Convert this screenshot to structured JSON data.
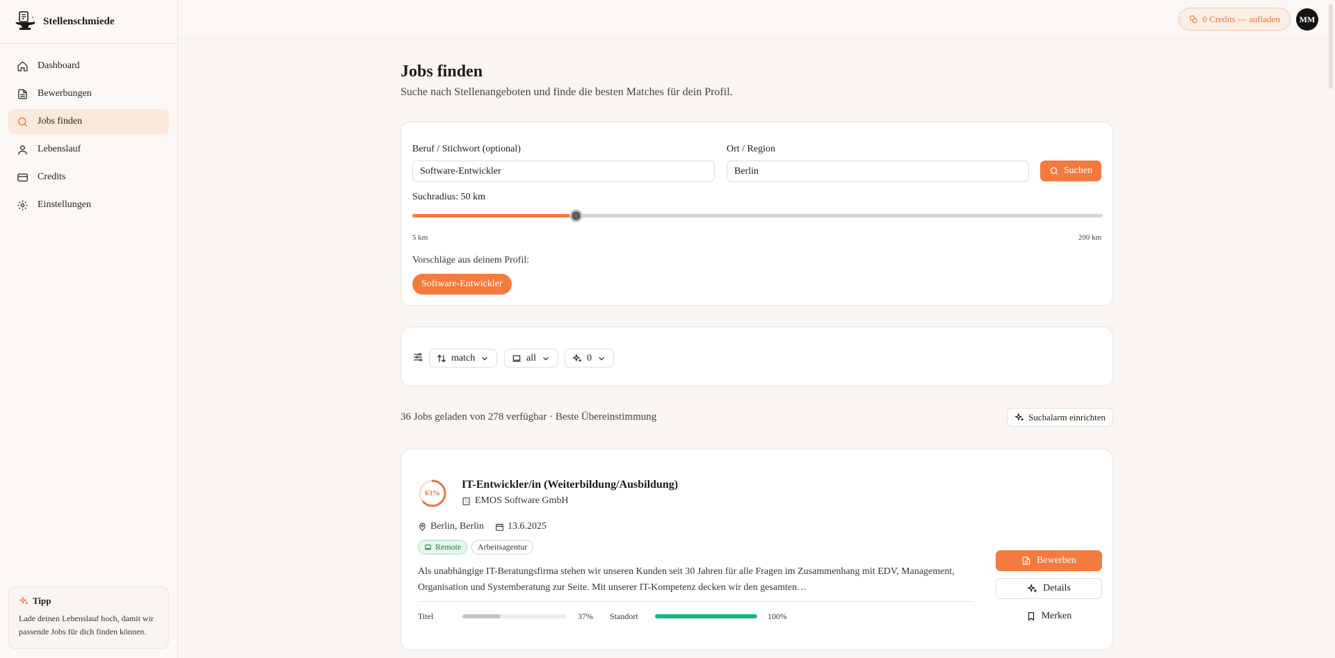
{
  "brand": {
    "name": "Stellenschmiede"
  },
  "sidebar": {
    "items": [
      {
        "label": "Dashboard",
        "icon": "home-icon"
      },
      {
        "label": "Bewerbungen",
        "icon": "document-icon"
      },
      {
        "label": "Jobs finden",
        "icon": "search-icon",
        "active": true
      },
      {
        "label": "Lebenslauf",
        "icon": "user-icon"
      },
      {
        "label": "Credits",
        "icon": "credit-card-icon"
      },
      {
        "label": "Einstellungen",
        "icon": "gear-icon"
      }
    ],
    "tip": {
      "title": "Tipp",
      "text": "Lade deinen Lebenslauf hoch, damit wir passende Jobs für dich finden können."
    }
  },
  "topbar": {
    "credits_label": "0 Credits — aufladen",
    "avatar_initials": "MM"
  },
  "page": {
    "title": "Jobs finden",
    "subtitle": "Suche nach Stellenangeboten und finde die besten Matches für dein Profil."
  },
  "search": {
    "keyword_label": "Beruf / Stichwort (optional)",
    "keyword_value": "Software-Entwickler",
    "location_label": "Ort / Region",
    "location_value": "Berlin",
    "submit_label": "Suchen",
    "radius_label": "Suchradius: 50 km",
    "radius_value": 50,
    "radius_min_label": "5 km",
    "radius_max_label": "200 km",
    "radius_min": 5,
    "radius_max": 200,
    "suggestions_label": "Vorschläge aus deinem Profil:",
    "suggestions": [
      "Software-Entwickler"
    ]
  },
  "filters": {
    "sort_value": "match",
    "worktype_value": "all",
    "ai_value": "0"
  },
  "results": {
    "summary": "36 Jobs geladen von 278 verfügbar · Beste Übereinstimmung",
    "alarm_label": "Suchalarm einrichten"
  },
  "job": {
    "match_label": "63%",
    "match_value": 63,
    "title": "IT-Entwickler/in (Weiterbildung/Ausbildung)",
    "company": "EMOS Software GmbH",
    "location": "Berlin, Berlin",
    "date": "13.6.2025",
    "tag_remote": "Remote",
    "tag_source": "Arbeitsagentur",
    "description": "Als unabhängige IT-Beratungsfirma stehen wir unseren Kunden seit 30 Jahren für alle Fragen im Zusammenhang mit EDV, Management, Organisation und Systemberatung zur Seite. Mit unserer IT-Kompetenz decken wir den gesamten…",
    "score_title_label": "Titel",
    "score_title_text": "37%",
    "score_title_value": 37,
    "score_location_label": "Standort",
    "score_location_text": "100%",
    "score_location_value": 100,
    "apply_label": "Bewerben",
    "details_label": "Details",
    "save_label": "Merken"
  },
  "colors": {
    "accent": "#f47a3e",
    "success": "#10b981",
    "neutral_bar": "#c9c4c0"
  }
}
